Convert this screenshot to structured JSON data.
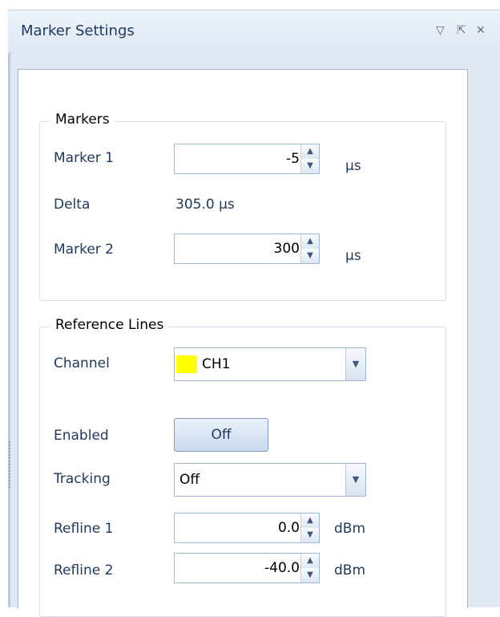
{
  "window": {
    "title": "Marker Settings",
    "icons": {
      "dropdown": "▽",
      "pin": "⇱",
      "close": "✕"
    }
  },
  "markers": {
    "title": "Markers",
    "marker1": {
      "label": "Marker 1",
      "value": "-5",
      "unit": "µs"
    },
    "delta": {
      "label": "Delta",
      "value": "305.0 µs"
    },
    "marker2": {
      "label": "Marker 2",
      "value": "300",
      "unit": "µs"
    }
  },
  "reference_lines": {
    "title": "Reference Lines",
    "channel": {
      "label": "Channel",
      "value": "CH1",
      "swatch_color": "#ffff00"
    },
    "enabled": {
      "label": "Enabled",
      "value": "Off"
    },
    "tracking": {
      "label": "Tracking",
      "value": "Off"
    },
    "refline1": {
      "label": "Refline 1",
      "value": "0.0",
      "unit": "dBm"
    },
    "refline2": {
      "label": "Refline 2",
      "value": "-40.0",
      "unit": "dBm"
    }
  },
  "colors": {
    "accent": "#1e395b",
    "panel_bg": "#dfe8f3",
    "border": "#9fb8d5"
  }
}
